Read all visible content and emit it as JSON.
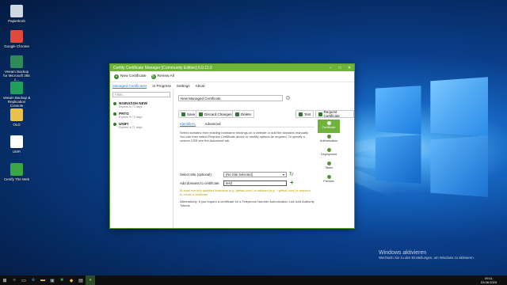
{
  "desktop_icons": [
    {
      "label": "Papierkorb",
      "icon": "recycle-bin-icon",
      "color": "#cfd8e0"
    },
    {
      "label": "Google Chrome",
      "icon": "chrome-icon",
      "color": "#e04a3a"
    },
    {
      "label": "Veeam Backup for Microsoft 365 c...",
      "icon": "veeam-icon",
      "color": "#2e8b57"
    },
    {
      "label": "Veeam Backup & Replication Console",
      "icon": "veeam-icon",
      "color": "#1fa05a"
    },
    {
      "label": "OLD",
      "icon": "folder-icon",
      "color": "#e8c14a"
    },
    {
      "label": "UniFi",
      "icon": "unifi-icon",
      "color": "#ffffff"
    },
    {
      "label": "Certify The Web",
      "icon": "certify-icon",
      "color": "#3aa842"
    }
  ],
  "window": {
    "title": "Certify Certificate Manager [Community Edition] 6.0.11.0",
    "controls": [
      "–",
      "□",
      "✕"
    ],
    "toolbar": {
      "new_certificate": "New Certificate",
      "renew_all": "Renew All"
    },
    "tabs": [
      "Managed Certificates",
      "In Progress",
      "Settings",
      "About"
    ],
    "filter_placeholder": "Filter...",
    "certificates": [
      {
        "name": "NGINXSSH NEW",
        "expiry": "Expires in 73 days"
      },
      {
        "name": "PRTG",
        "expiry": "Expires in 73 days"
      },
      {
        "name": "UNIFI",
        "expiry": "Expires in 71 days"
      }
    ],
    "cert_name_value": "New Managed Certificate",
    "help": "?",
    "actions": {
      "save": "Save",
      "discard": "Discard Changes",
      "delete": "Delete",
      "test": "Test",
      "request": "Request Certificate"
    },
    "subtabs": [
      "Identifiers",
      "Advanced"
    ],
    "description": "Select domains from existing hostname bindings on a website or add the domains manually. You can then select Request Certificate above or modify options as required. To specify a custom CSR see the Advanced tab.",
    "select_site_label": "Select Site (optional):",
    "select_site_value": "(No Site Selected)",
    "add_domains_label": "Add domains to certificate:",
    "add_domains_value": "test|",
    "warning": "At least one fully qualified hostname (e.g. 'giftsdc.com') or wildcard (e.g. '*.giftsdc.com') is required to create a certificate.",
    "alt_text": "Alternatively, if you require a certificate for a Telephone Number Authorization List: Add Authority Tokens",
    "sidebar": [
      "Certificate",
      "Authorization",
      "Deployment",
      "Tasks",
      "Preview"
    ]
  },
  "taskbar": {
    "activation_title": "Windows aktivieren",
    "activation_sub": "Wechseln Sie zu den Einstellungen, um Windows zu aktivieren.",
    "time": "09:11",
    "date": "03.08.2023"
  },
  "colors": {
    "accent": "#6fb33a",
    "link": "#3a7bd5",
    "warning": "#b89a00"
  }
}
